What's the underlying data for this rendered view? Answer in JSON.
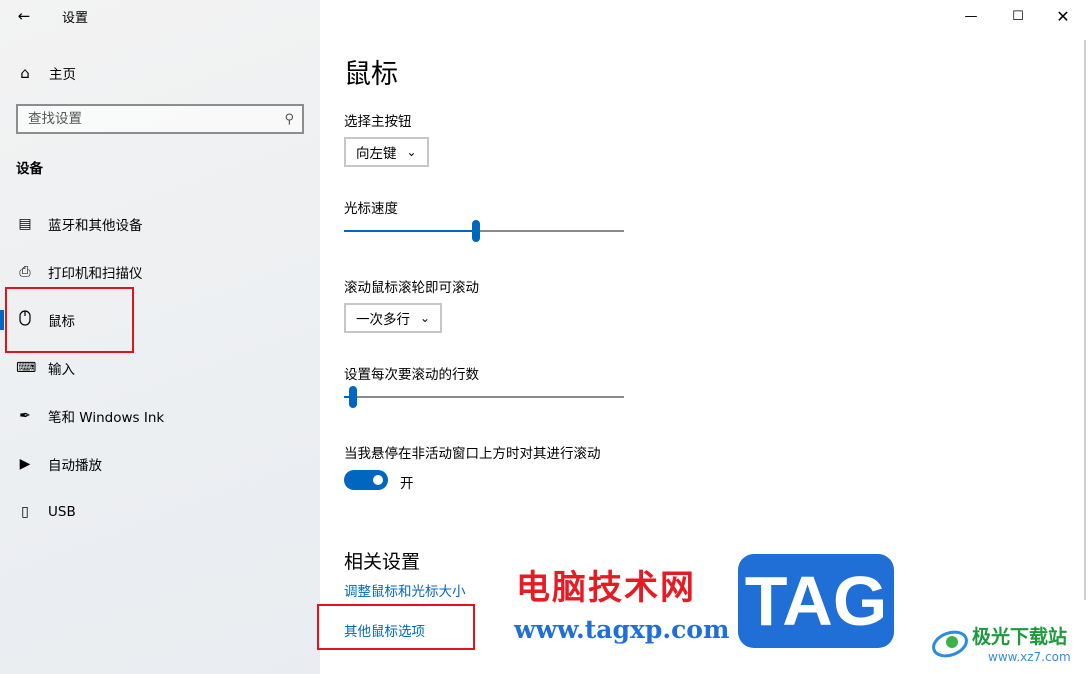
{
  "window": {
    "title": "设置"
  },
  "sidebar": {
    "home_label": "主页",
    "search_placeholder": "查找设置",
    "section_label": "设备",
    "items": [
      {
        "label": "蓝牙和其他设备",
        "icon": "bluetooth-devices-icon"
      },
      {
        "label": "打印机和扫描仪",
        "icon": "printer-icon"
      },
      {
        "label": "鼠标",
        "icon": "mouse-icon",
        "active": true
      },
      {
        "label": "输入",
        "icon": "keyboard-icon"
      },
      {
        "label": "笔和 Windows Ink",
        "icon": "pen-icon"
      },
      {
        "label": "自动播放",
        "icon": "autoplay-icon"
      },
      {
        "label": "USB",
        "icon": "usb-icon"
      }
    ]
  },
  "main": {
    "title": "鼠标",
    "primary_button": {
      "label": "选择主按钮",
      "value": "向左键"
    },
    "cursor_speed": {
      "label": "光标速度",
      "value_fraction": 0.47
    },
    "wheel_scroll": {
      "label": "滚动鼠标滚轮即可滚动",
      "value": "一次多行"
    },
    "lines_per_scroll": {
      "label": "设置每次要滚动的行数",
      "value_fraction": 0.02
    },
    "inactive_scroll": {
      "label": "当我悬停在非活动窗口上方时对其进行滚动",
      "state": "开",
      "on": true
    },
    "related": {
      "title": "相关设置",
      "links": [
        "调整鼠标和光标大小",
        "其他鼠标选项"
      ]
    }
  },
  "watermark": {
    "cn_text": "电脑技术网",
    "url": "www.tagxp.com",
    "tag": "TAG",
    "logo_name": "极光下载站",
    "logo_site": "www.xz7.com"
  },
  "colors": {
    "accent": "#0067c0",
    "highlight": "#e0141e"
  }
}
